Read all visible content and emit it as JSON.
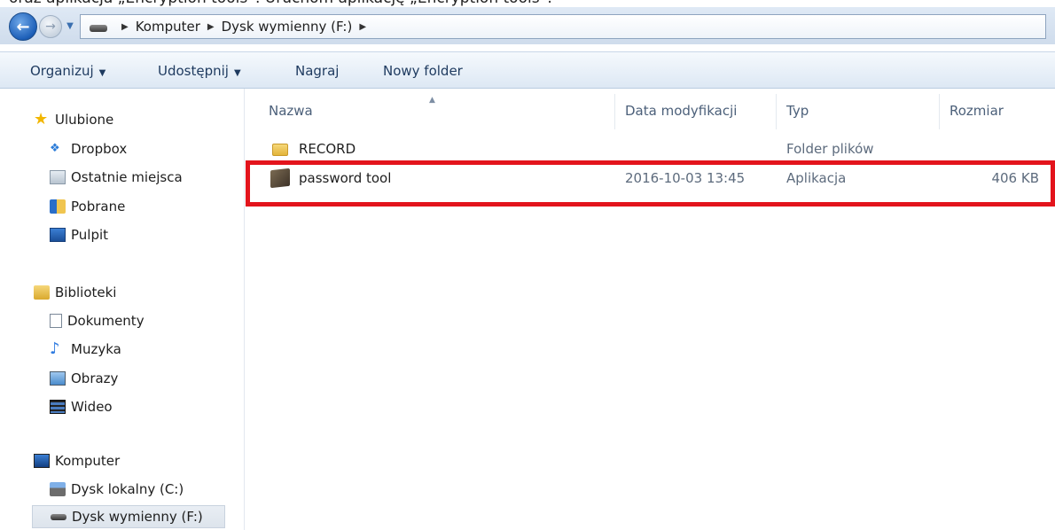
{
  "caption": "oraz aplikacja „Encryption tools”. Uruchom aplikację „Encryption tools”.",
  "address": {
    "crumbs": [
      "Komputer",
      "Dysk wymienny (F:)"
    ]
  },
  "toolbar": {
    "organize": "Organizuj",
    "share": "Udostępnij",
    "burn": "Nagraj",
    "new_folder": "Nowy folder"
  },
  "sidebar": {
    "favorites_header": "Ulubione",
    "favorites": [
      "Dropbox",
      "Ostatnie miejsca",
      "Pobrane",
      "Pulpit"
    ],
    "libraries_header": "Biblioteki",
    "libraries": [
      "Dokumenty",
      "Muzyka",
      "Obrazy",
      "Wideo"
    ],
    "computer_header": "Komputer",
    "computer": [
      "Dysk lokalny (C:)",
      "Dysk wymienny (F:)"
    ]
  },
  "columns": {
    "name": "Nazwa",
    "date": "Data modyfikacji",
    "type": "Typ",
    "size": "Rozmiar"
  },
  "files": [
    {
      "name": "RECORD",
      "date": "",
      "type": "Folder plików",
      "size": ""
    },
    {
      "name": "password tool",
      "date": "2016-10-03 13:45",
      "type": "Aplikacja",
      "size": "406 KB"
    }
  ],
  "colors": {
    "highlight": "#e3141c",
    "accent": "#1d5fb8"
  }
}
